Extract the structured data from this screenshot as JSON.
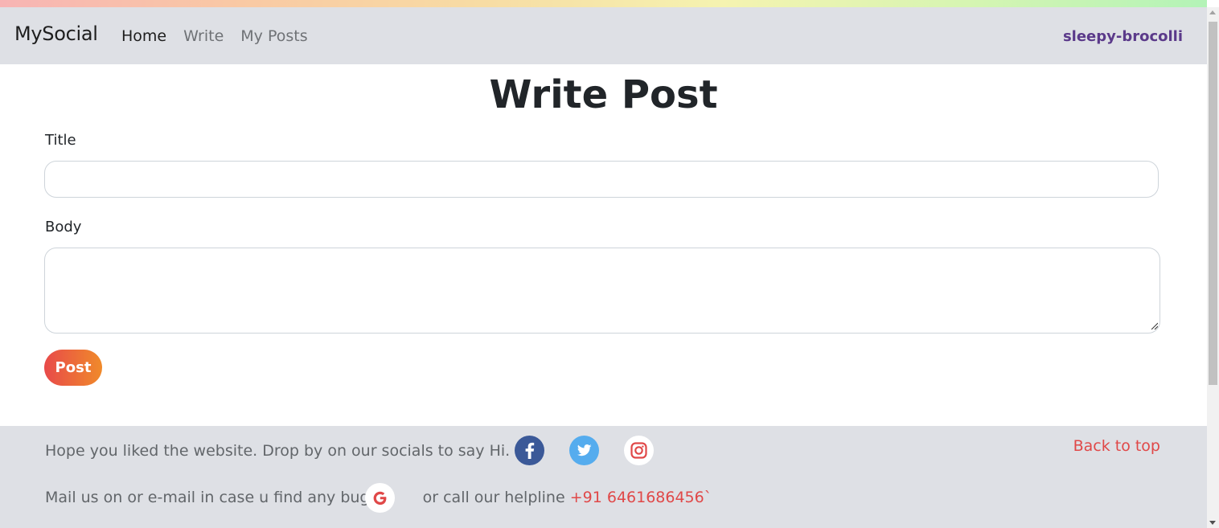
{
  "navbar": {
    "brand": "MySocial",
    "links": [
      {
        "label": "Home",
        "active": true
      },
      {
        "label": "Write",
        "active": false
      },
      {
        "label": "My Posts",
        "active": false
      }
    ],
    "username": "sleepy-brocolli"
  },
  "form": {
    "heading": "Write Post",
    "title_label": "Title",
    "title_value": "",
    "body_label": "Body",
    "body_value": "",
    "submit_label": "Post"
  },
  "footer": {
    "line1": "Hope you liked the website. Drop by on our socials to say Hi.",
    "line2_prefix": "Mail us on or e-mail in case u find any bug.",
    "line2_middle": "or call our helpline",
    "helpline_number": "+91 6461686456`",
    "back_to_top": "Back to top",
    "socials": [
      "facebook-icon",
      "twitter-icon",
      "instagram-icon"
    ],
    "mail_icon": "gmail-icon"
  },
  "colors": {
    "navbar_bg": "#dee0e5",
    "username": "#5b3a8a",
    "accent_red": "#e04848",
    "button_gradient_start": "#e84a4a",
    "button_gradient_end": "#f08a2a",
    "facebook": "#3b5998",
    "twitter": "#55acee"
  }
}
